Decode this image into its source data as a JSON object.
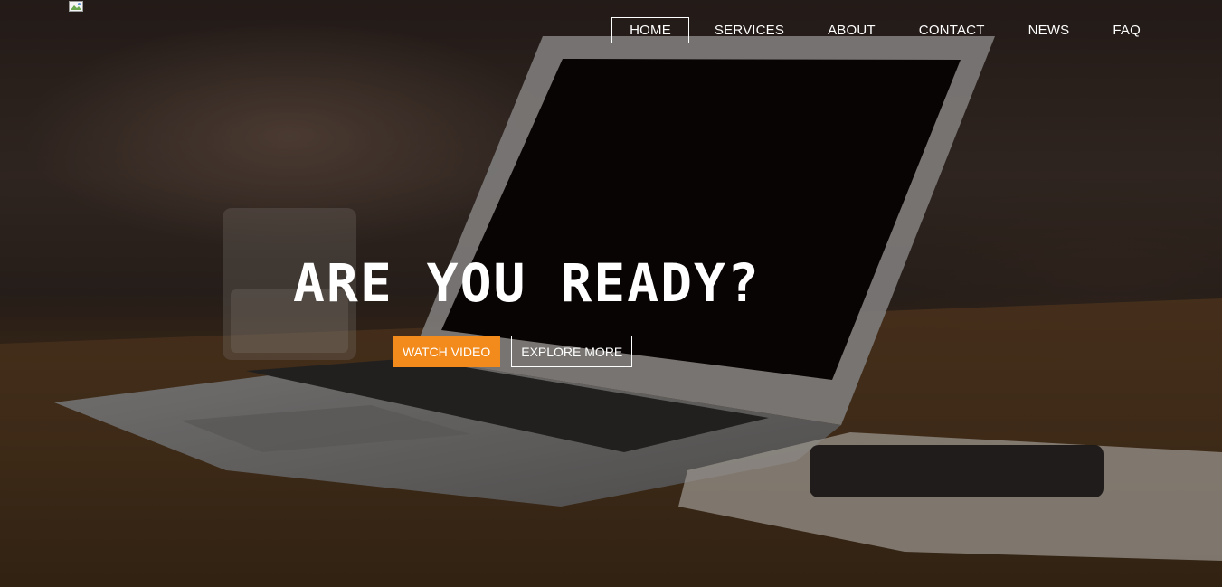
{
  "header": {
    "logo_icon": "broken-image-icon",
    "nav": [
      {
        "label": "HOME",
        "active": true
      },
      {
        "label": "SERVICES",
        "active": false
      },
      {
        "label": "ABOUT",
        "active": false
      },
      {
        "label": "CONTACT",
        "active": false
      },
      {
        "label": "NEWS",
        "active": false
      },
      {
        "label": "FAQ",
        "active": false
      }
    ]
  },
  "hero": {
    "headline": "ARE YOU READY?",
    "primary_button": "WATCH VIDEO",
    "secondary_button": "EXPLORE MORE"
  },
  "colors": {
    "accent": "#f28a1c",
    "text": "#ffffff"
  }
}
